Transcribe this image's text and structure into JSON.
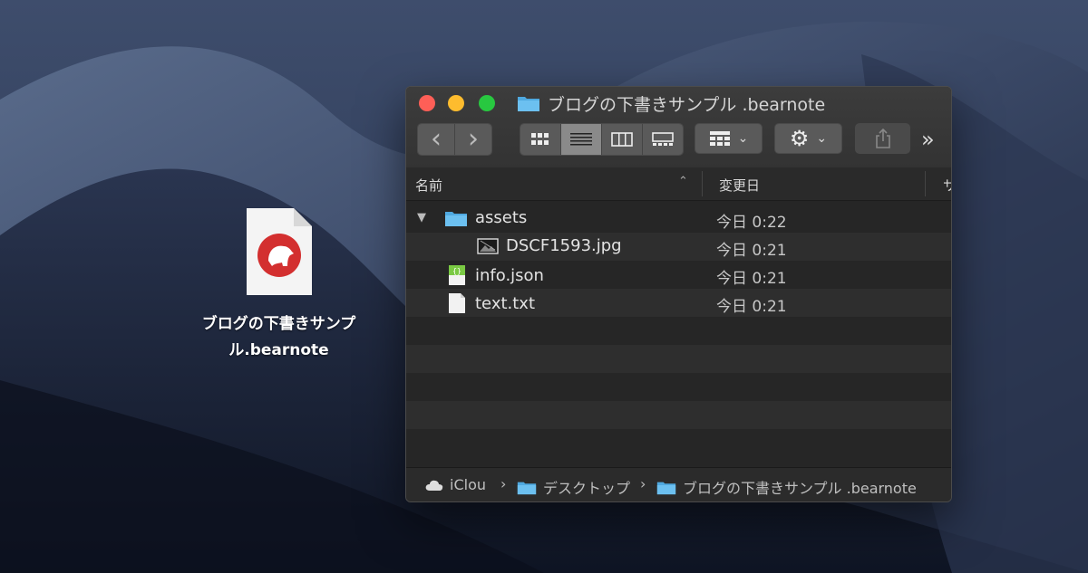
{
  "desktop": {
    "file_label": "ブログの下書きサンプル.bearnote"
  },
  "window": {
    "title": "ブログの下書きサンプル .bearnote",
    "toolbar": {
      "back_label": "‹",
      "forward_label": "›",
      "more_label": "»"
    },
    "columns": {
      "name": "名前",
      "modified": "変更日",
      "third": "サ"
    },
    "rows": [
      {
        "name": "assets",
        "date": "今日 0:22",
        "icon": "folder-icon",
        "expanded": true,
        "indent": 0
      },
      {
        "name": "DSCF1593.jpg",
        "date": "今日 0:21",
        "icon": "image-file-icon",
        "indent": 1
      },
      {
        "name": "info.json",
        "date": "今日 0:21",
        "icon": "json-file-icon",
        "indent": 0
      },
      {
        "name": "text.txt",
        "date": "今日 0:21",
        "icon": "text-file-icon",
        "indent": 0
      }
    ],
    "path": {
      "items": [
        "iClou",
        "デスクトップ",
        "ブログの下書きサンプル .bearnote"
      ]
    }
  },
  "colors": {
    "close": "#fe5f57",
    "minimize": "#febc2e",
    "maximize": "#28c840",
    "folder": "#5fb8ec",
    "json": "#7ac943",
    "bear_red": "#d32f2f"
  }
}
